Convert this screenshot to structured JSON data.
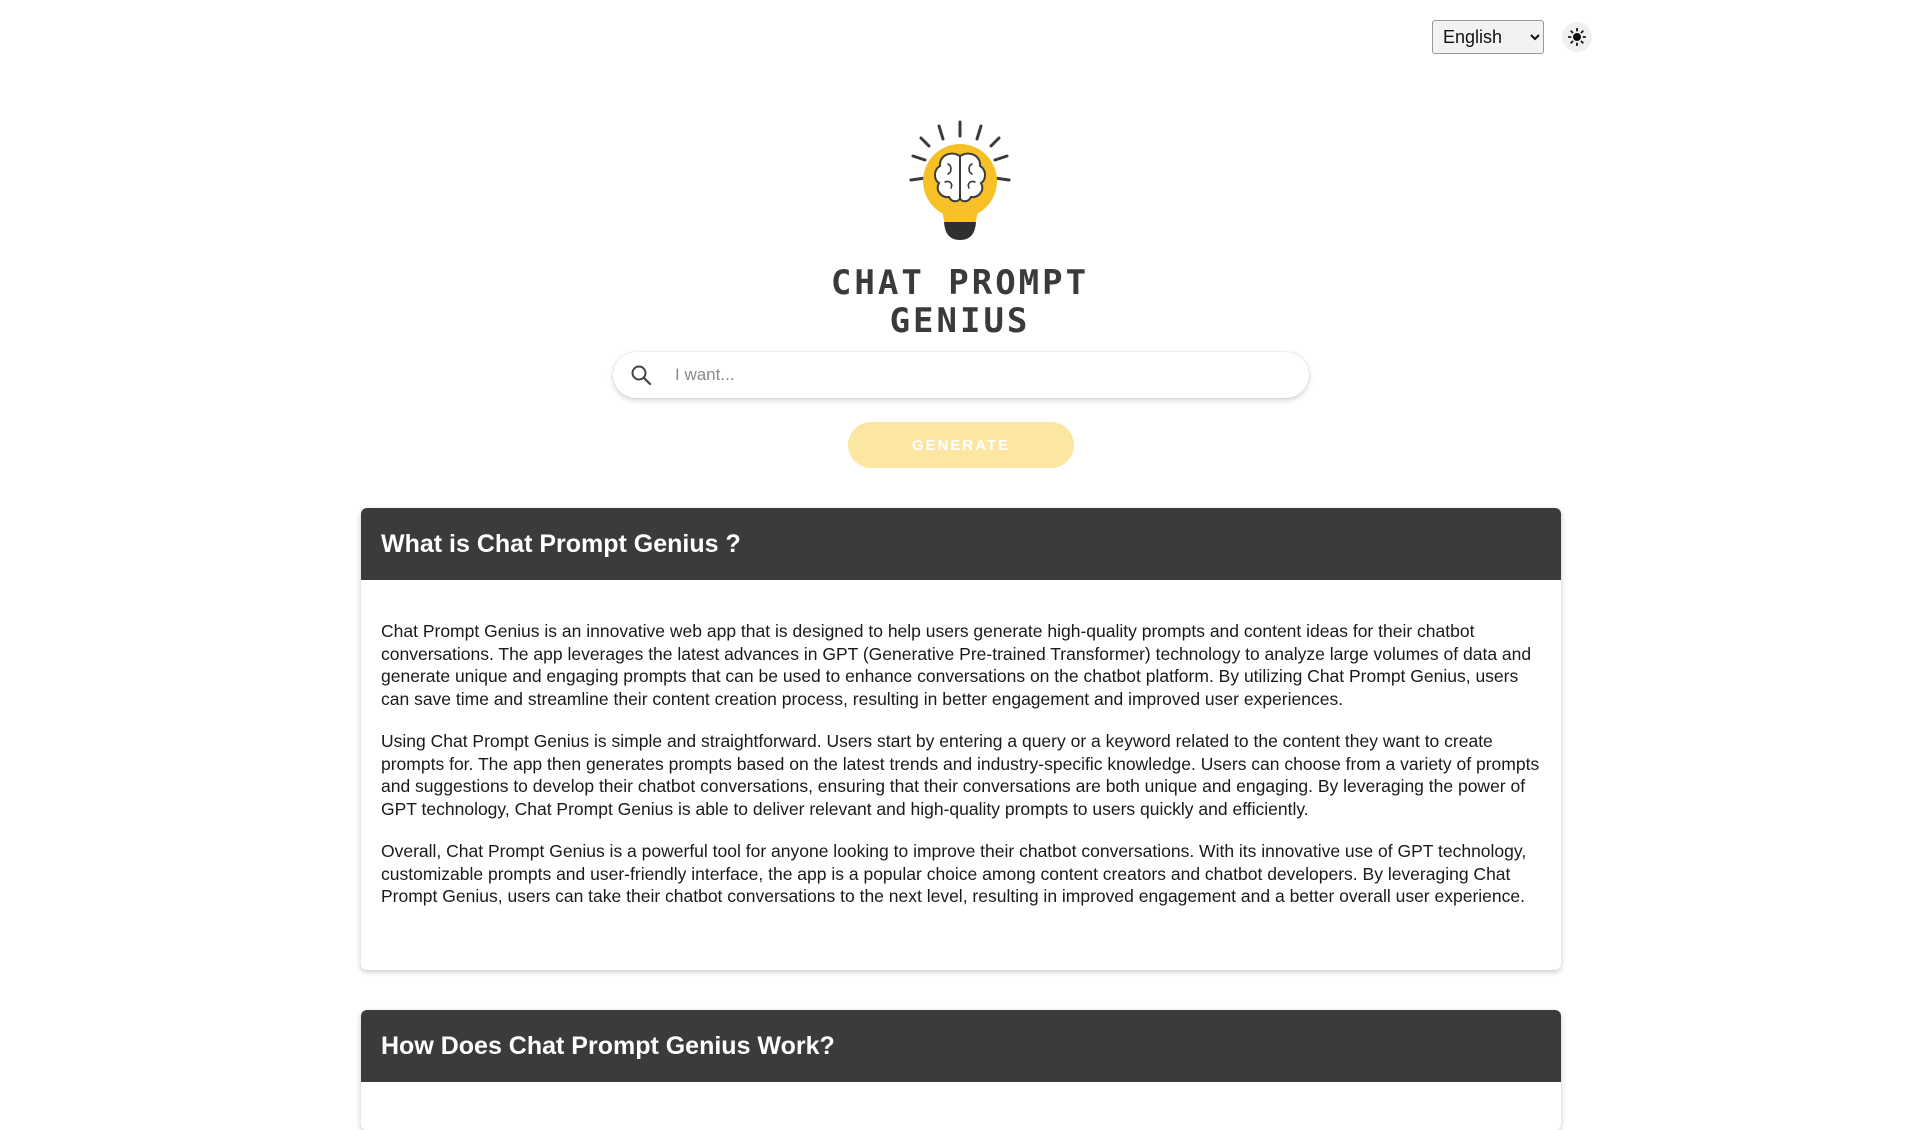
{
  "header": {
    "language_selected": "English",
    "theme_icon": "sun-icon"
  },
  "logo": {
    "icon": "lightbulb-brain-icon",
    "line1": "CHAT PROMPT",
    "line2": "GENIUS",
    "colors": {
      "bulb": "#f6c026",
      "dark": "#3a3a3a"
    }
  },
  "search": {
    "icon": "search-icon",
    "placeholder": "I want..."
  },
  "generate_button": {
    "label": "GENERATE",
    "color": "#fbe7a1"
  },
  "sections": [
    {
      "title": "What is Chat Prompt Genius ?",
      "paragraphs": [
        "Chat Prompt Genius is an innovative web app that is designed to help users generate high-quality prompts and content ideas for their chatbot conversations. The app leverages the latest advances in GPT (Generative Pre-trained Transformer) technology to analyze large volumes of data and generate unique and engaging prompts that can be used to enhance conversations on the chatbot platform. By utilizing Chat Prompt Genius, users can save time and streamline their content creation process, resulting in better engagement and improved user experiences.",
        "Using Chat Prompt Genius is simple and straightforward. Users start by entering a query or a keyword related to the content they want to create prompts for. The app then generates prompts based on the latest trends and industry-specific knowledge. Users can choose from a variety of prompts and suggestions to develop their chatbot conversations, ensuring that their conversations are both unique and engaging. By leveraging the power of GPT technology, Chat Prompt Genius is able to deliver relevant and high-quality prompts to users quickly and efficiently.",
        "Overall, Chat Prompt Genius is a powerful tool for anyone looking to improve their chatbot conversations. With its innovative use of GPT technology, customizable prompts and user-friendly interface, the app is a popular choice among content creators and chatbot developers. By leveraging Chat Prompt Genius, users can take their chatbot conversations to the next level, resulting in improved engagement and a better overall user experience."
      ]
    },
    {
      "title": "How Does Chat Prompt Genius Work?"
    }
  ]
}
